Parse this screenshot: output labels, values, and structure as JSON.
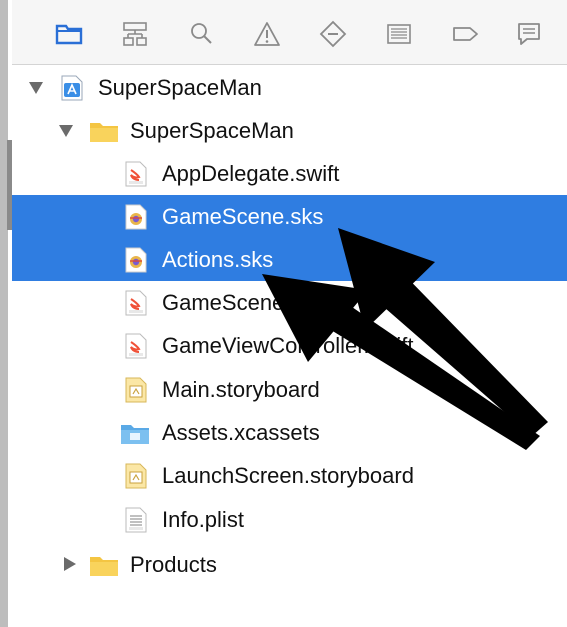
{
  "toolbar": {
    "icons": [
      "folder-icon",
      "hierarchy-icon",
      "search-icon",
      "warning-icon",
      "test-diamond-icon",
      "debug-list-icon",
      "breakpoint-tag-icon",
      "report-icon"
    ]
  },
  "tree": {
    "project": {
      "label": "SuperSpaceMan",
      "icon": "xcode-project-icon"
    },
    "group": {
      "label": "SuperSpaceMan",
      "icon": "folder-icon"
    },
    "files": [
      {
        "label": "AppDelegate.swift",
        "icon": "swift-file-icon"
      },
      {
        "label": "GameScene.sks",
        "icon": "sks-file-icon",
        "selected": true
      },
      {
        "label": "Actions.sks",
        "icon": "sks-file-icon",
        "selected": true
      },
      {
        "label": "GameScene.swift",
        "icon": "swift-file-icon"
      },
      {
        "label": "GameViewController.swift",
        "icon": "swift-file-icon"
      },
      {
        "label": "Main.storyboard",
        "icon": "storyboard-file-icon"
      },
      {
        "label": "Assets.xcassets",
        "icon": "asset-folder-icon"
      },
      {
        "label": "LaunchScreen.storyboard",
        "icon": "storyboard-file-icon"
      },
      {
        "label": "Info.plist",
        "icon": "plist-file-icon"
      }
    ],
    "products": {
      "label": "Products",
      "icon": "folder-icon"
    }
  },
  "colors": {
    "selection": "#2f7de1",
    "toolbar_icon": "#2a6fd6",
    "folder": "#f4c542",
    "swift": "#f05138",
    "arrow": "#000000"
  }
}
